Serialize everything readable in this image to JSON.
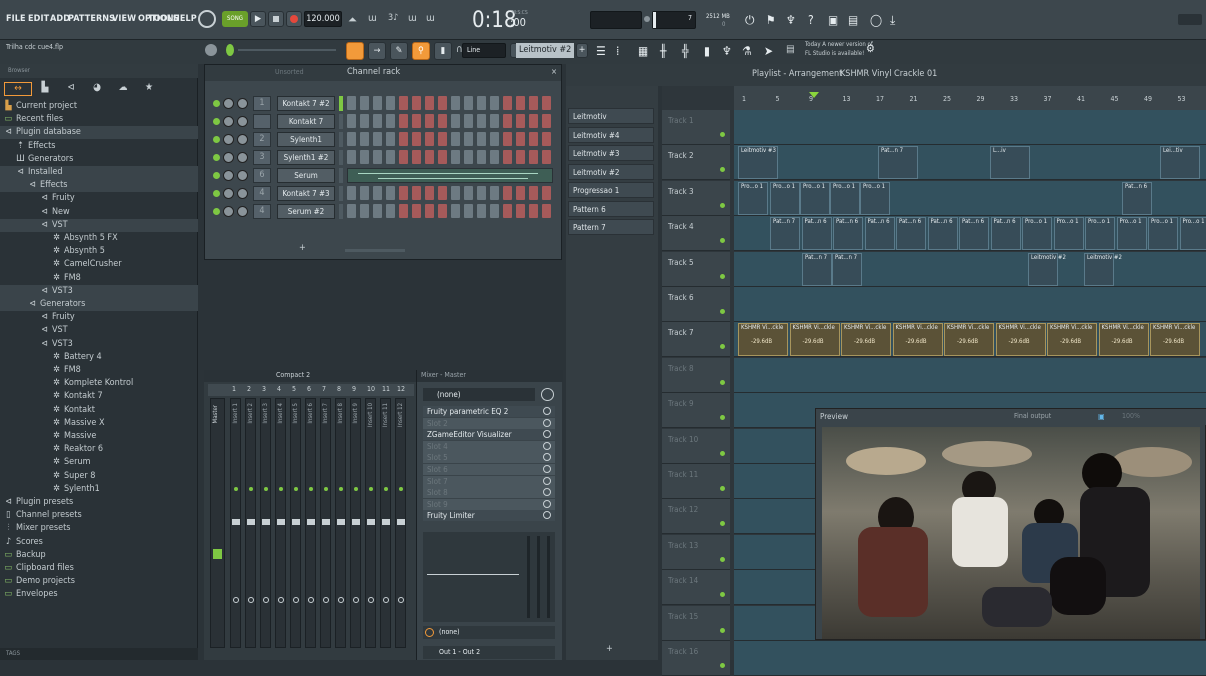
{
  "menu": {
    "items": [
      "FILE",
      "EDIT",
      "ADD",
      "PATTERNS",
      "VIEW",
      "OPTIONS",
      "TOOLS",
      "HELP"
    ],
    "song_label": "SONG",
    "tempo": "120.000",
    "time": "0:18",
    "time_small": ":00",
    "time_unit": "M:S:CS",
    "cpu_value": "7",
    "mem": "2512 MB",
    "mem_sub": "0",
    "update_line1": "Today  A newer version of",
    "update_line2": "FL Studio is available!"
  },
  "hint": {
    "project_file": "Trilha cdc cue4.flp",
    "snap_mode": "Line",
    "current_pattern": "Leitmotiv #2"
  },
  "browser": {
    "header": "Browser",
    "items": [
      {
        "label": "Current project",
        "icon": "project-icon",
        "indent": 0
      },
      {
        "label": "Recent files",
        "icon": "folder-icon",
        "indent": 0
      },
      {
        "label": "Plugin database",
        "icon": "plug-icon",
        "indent": 0,
        "selected": true
      },
      {
        "label": "Effects",
        "icon": "effects-icon",
        "indent": 1
      },
      {
        "label": "Generators",
        "icon": "generators-icon",
        "indent": 1
      },
      {
        "label": "Installed",
        "icon": "plug-icon",
        "indent": 1,
        "selected": true
      },
      {
        "label": "Effects",
        "icon": "plug-icon",
        "indent": 2,
        "selected": true
      },
      {
        "label": "Fruity",
        "icon": "plug-icon",
        "indent": 3
      },
      {
        "label": "New",
        "icon": "plug-icon",
        "indent": 3
      },
      {
        "label": "VST",
        "icon": "plug-icon",
        "indent": 3,
        "selected": true
      },
      {
        "label": "Absynth 5 FX",
        "icon": "gear-icon",
        "indent": 4
      },
      {
        "label": "Absynth 5",
        "icon": "gear-icon",
        "indent": 4
      },
      {
        "label": "CamelCrusher",
        "icon": "gear-icon",
        "indent": 4
      },
      {
        "label": "FM8",
        "icon": "gear-icon",
        "indent": 4
      },
      {
        "label": "VST3",
        "icon": "plug-icon",
        "indent": 3,
        "selected": true
      },
      {
        "label": "Generators",
        "icon": "plug-icon",
        "indent": 2,
        "selected": true
      },
      {
        "label": "Fruity",
        "icon": "plug-icon",
        "indent": 3
      },
      {
        "label": "VST",
        "icon": "plug-icon",
        "indent": 3
      },
      {
        "label": "VST3",
        "icon": "plug-icon",
        "indent": 3
      },
      {
        "label": "Battery 4",
        "icon": "gear-icon",
        "indent": 4
      },
      {
        "label": "FM8",
        "icon": "gear-icon",
        "indent": 4
      },
      {
        "label": "Komplete Kontrol",
        "icon": "gear-icon",
        "indent": 4
      },
      {
        "label": "Kontakt 7",
        "icon": "gear-icon",
        "indent": 4
      },
      {
        "label": "Kontakt",
        "icon": "gear-icon",
        "indent": 4
      },
      {
        "label": "Massive X",
        "icon": "gear-icon",
        "indent": 4
      },
      {
        "label": "Massive",
        "icon": "gear-icon",
        "indent": 4
      },
      {
        "label": "Reaktor 6",
        "icon": "gear-icon",
        "indent": 4
      },
      {
        "label": "Serum",
        "icon": "gear-icon",
        "indent": 4
      },
      {
        "label": "Super 8",
        "icon": "gear-icon",
        "indent": 4
      },
      {
        "label": "Sylenth1",
        "icon": "gear-icon",
        "indent": 4
      },
      {
        "label": "Plugin presets",
        "icon": "plug-icon",
        "indent": 0
      },
      {
        "label": "Channel presets",
        "icon": "channel-icon",
        "indent": 0
      },
      {
        "label": "Mixer presets",
        "icon": "mixer-icon",
        "indent": 0
      },
      {
        "label": "Scores",
        "icon": "note-icon",
        "indent": 0
      },
      {
        "label": "Backup",
        "icon": "folder-icon",
        "indent": 0
      },
      {
        "label": "Clipboard files",
        "icon": "folder-icon",
        "indent": 0
      },
      {
        "label": "Demo projects",
        "icon": "folder-icon",
        "indent": 0
      },
      {
        "label": "Envelopes",
        "icon": "folder-icon",
        "indent": 0
      }
    ],
    "tags_label": "TAGS"
  },
  "rack": {
    "filter": "Unsorted",
    "title": "Channel rack",
    "channels": [
      {
        "num": "1",
        "name": "Kontakt 7 #2",
        "type": "steps"
      },
      {
        "num": "",
        "name": "Kontakt 7",
        "type": "steps"
      },
      {
        "num": "2",
        "name": "Sylenth1",
        "type": "steps"
      },
      {
        "num": "3",
        "name": "Sylenth1 #2",
        "type": "steps"
      },
      {
        "num": "6",
        "name": "Serum",
        "type": "notes"
      },
      {
        "num": "4",
        "name": "Kontakt 7 #3",
        "type": "steps"
      },
      {
        "num": "4",
        "name": "Serum #2",
        "type": "steps"
      }
    ],
    "add_label": "+"
  },
  "mixer": {
    "view_mode": "Compact 2",
    "master_label": "Master",
    "insert_numbers": [
      "1",
      "2",
      "3",
      "4",
      "5",
      "6",
      "7",
      "8",
      "9",
      "10",
      "11",
      "12"
    ],
    "insert_labels": [
      "Insert 1",
      "Insert 2",
      "Insert 3",
      "Insert 4",
      "Insert 5",
      "Insert 6",
      "Insert 7",
      "Insert 8",
      "Insert 9",
      "Insert 10",
      "Insert 11",
      "Insert 12"
    ]
  },
  "mixer_panel": {
    "title": "Mixer - Master",
    "preset": "(none)",
    "slots": [
      {
        "label": "Fruity parametric EQ 2",
        "active": true
      },
      {
        "label": "Slot 2",
        "active": false
      },
      {
        "label": "ZGameEditor Visualizer",
        "active": true
      },
      {
        "label": "Slot 4",
        "active": false
      },
      {
        "label": "Slot 5",
        "active": false
      },
      {
        "label": "Slot 6",
        "active": false
      },
      {
        "label": "Slot 7",
        "active": false
      },
      {
        "label": "Slot 8",
        "active": false
      },
      {
        "label": "Slot 9",
        "active": false
      },
      {
        "label": "Fruity Limiter",
        "active": true
      }
    ],
    "input": "(none)",
    "output": "Out 1 - Out 2"
  },
  "patterns": {
    "items": [
      "Leitmotiv",
      "Leitmotiv #4",
      "Leitmotiv #3",
      "Leitmotiv #2",
      "Progressao 1",
      "Pattern 6",
      "Pattern 7"
    ],
    "add_label": "+"
  },
  "playlist": {
    "title": "Playlist - Arrangement",
    "arrangement": "KSHMR Vinyl Crackle 01",
    "ruler": [
      "1",
      "5",
      "9",
      "13",
      "17",
      "21",
      "25",
      "29",
      "33",
      "37",
      "41",
      "45",
      "49",
      "53"
    ],
    "tracks": [
      {
        "name": "Track 1",
        "dim": true
      },
      {
        "name": "Track 2",
        "dim": false
      },
      {
        "name": "Track 3",
        "dim": false
      },
      {
        "name": "Track 4",
        "dim": false
      },
      {
        "name": "Track 5",
        "dim": false
      },
      {
        "name": "Track 6",
        "dim": false
      },
      {
        "name": "Track 7",
        "dim": false
      },
      {
        "name": "Track 8",
        "dim": true
      },
      {
        "name": "Track 9",
        "dim": true
      },
      {
        "name": "Track 10",
        "dim": true
      },
      {
        "name": "Track 11",
        "dim": true
      },
      {
        "name": "Track 12",
        "dim": true
      },
      {
        "name": "Track 13",
        "dim": true
      },
      {
        "name": "Track 14",
        "dim": true
      },
      {
        "name": "Track 15",
        "dim": true
      },
      {
        "name": "Track 16",
        "dim": true
      }
    ],
    "clips": {
      "track2": [
        "Leitmotiv #3",
        "Pat...n 7",
        "L...iv",
        "Lei...tiv"
      ],
      "track3": [
        "Pro...o 1",
        "Pro...o 1",
        "Pro...o 1",
        "Pro...o 1",
        "Pro...o 1",
        "Pat...n 6"
      ],
      "track4": [
        "Pat...n 7",
        "Pat...n 6",
        "Pat...n 6",
        "Pat...n 6",
        "Pat...n 6",
        "Pat...n 6",
        "Pat...n 6",
        "Pat...n 6",
        "Pro...o 1",
        "Pro...o 1",
        "Pro...o 1",
        "Pro...o 1",
        "Pro...o 1",
        "Pro...o 1"
      ],
      "track5": [
        "Pat...n 7",
        "Pat...n 7",
        "Leitmotiv #2",
        "Leitmotiv #2"
      ],
      "track7_label": "KSHMR Vi...ckle",
      "track7_db": "-29.6dB"
    }
  },
  "preview": {
    "title": "Preview",
    "output": "Final output",
    "zoom": "100%"
  },
  "colors": {
    "accent": "#f29a3a",
    "led_green": "#7ec843",
    "step_red": "#c65a5a",
    "clip_bg": "#374c58"
  }
}
